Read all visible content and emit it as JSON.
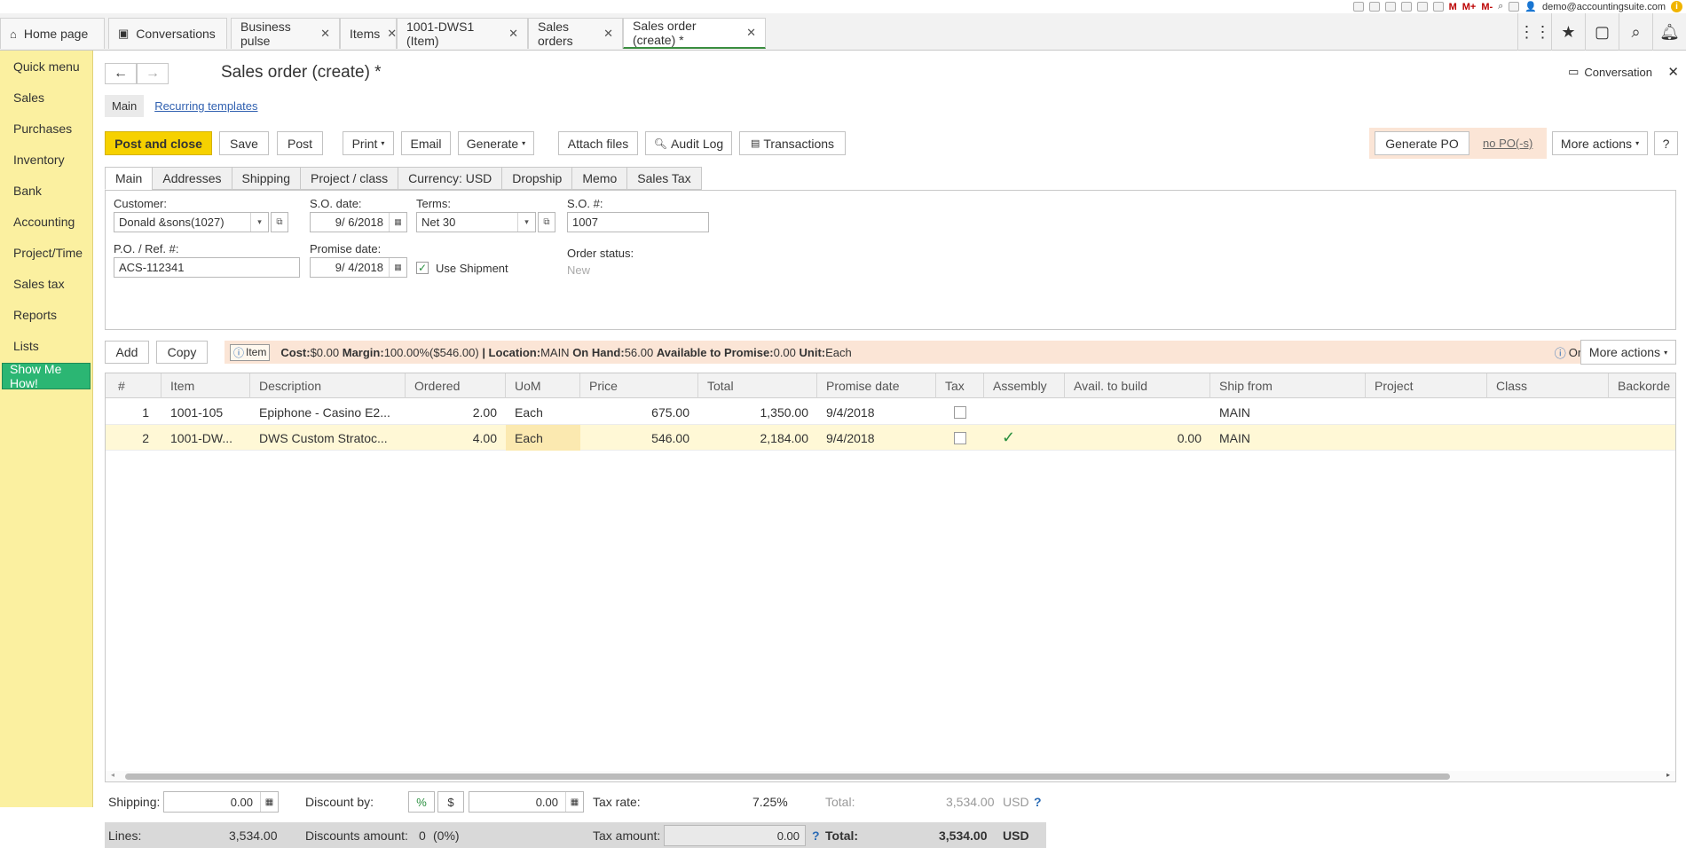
{
  "topbar": {
    "mplus": "M+",
    "mminus": "M-",
    "m": "M",
    "user": "demo@accountingsuite.com"
  },
  "open_tabs": [
    {
      "label": "Home page"
    },
    {
      "label": "Conversations"
    },
    {
      "label": "Business pulse"
    },
    {
      "label": "Items"
    },
    {
      "label": "1001-DWS1 (Item)"
    },
    {
      "label": "Sales orders"
    },
    {
      "label": "Sales order (create) *"
    }
  ],
  "sidebar": {
    "items": [
      {
        "label": "Quick menu"
      },
      {
        "label": "Sales"
      },
      {
        "label": "Purchases"
      },
      {
        "label": "Inventory"
      },
      {
        "label": "Bank"
      },
      {
        "label": "Accounting"
      },
      {
        "label": "Project/Time"
      },
      {
        "label": "Sales tax"
      },
      {
        "label": "Reports"
      },
      {
        "label": "Lists"
      }
    ],
    "show_me": "Show Me How!"
  },
  "page": {
    "title": "Sales order (create) *",
    "conversation": "Conversation",
    "subtab_main": "Main",
    "subtab_recurring": "Recurring templates"
  },
  "toolbar": {
    "post_close": "Post and close",
    "save": "Save",
    "post": "Post",
    "print": "Print",
    "email": "Email",
    "generate": "Generate",
    "attach": "Attach files",
    "audit": "Audit Log",
    "transactions": "Transactions",
    "generate_po": "Generate PO",
    "no_po": "no PO(-s)",
    "more_actions": "More actions",
    "help": "?"
  },
  "form_tabs": [
    "Main",
    "Addresses",
    "Shipping",
    "Project / class",
    "Currency: USD",
    "Dropship",
    "Memo",
    "Sales Tax"
  ],
  "form": {
    "customer_label": "Customer:",
    "customer_value": "Donald &sons(1027)",
    "so_date_label": "S.O. date:",
    "so_date_value": "9/ 6/2018",
    "terms_label": "Terms:",
    "terms_value": "Net 30",
    "so_num_label": "S.O. #:",
    "so_num_value": "1007",
    "po_label": "P.O. / Ref. #:",
    "po_value": "ACS-112341",
    "promise_label": "Promise date:",
    "promise_value": "9/ 4/2018",
    "use_shipment": "Use Shipment",
    "order_status_label": "Order status:",
    "order_status_value": "New"
  },
  "items_bar": {
    "add": "Add",
    "copy": "Copy",
    "item_tag": "Item",
    "cost_label": "Cost:",
    "cost_value": "$0.00",
    "margin_label": "Margin:",
    "margin_value": "100.00%($546.00)",
    "location_label": "| Location:",
    "location_value": "MAIN",
    "onhand_label": "On Hand:",
    "onhand_value": "56.00",
    "atp_label": "Available to Promise:",
    "atp_value": "0.00",
    "unit_label": "Unit:",
    "unit_value": "Each",
    "order": "Order",
    "more_actions": "More actions"
  },
  "grid": {
    "headers": [
      "#",
      "Item",
      "Description",
      "Ordered",
      "UoM",
      "Price",
      "Total",
      "Promise date",
      "Tax",
      "Assembly",
      "Avail. to build",
      "Ship from",
      "Project",
      "Class",
      "Backorde"
    ],
    "rows": [
      {
        "num": "1",
        "item": "1001-105",
        "description": "Epiphone - Casino E2...",
        "ordered": "2.00",
        "uom": "Each",
        "price": "675.00",
        "total": "1,350.00",
        "promise": "9/4/2018",
        "assembly": "",
        "avail": "",
        "ship_from": "MAIN"
      },
      {
        "num": "2",
        "item": "1001-DW...",
        "description": "DWS Custom Stratoc...",
        "ordered": "4.00",
        "uom": "Each",
        "price": "546.00",
        "total": "2,184.00",
        "promise": "9/4/2018",
        "assembly": "✓",
        "avail": "0.00",
        "ship_from": "MAIN"
      }
    ]
  },
  "footer": {
    "shipping_label": "Shipping:",
    "shipping_value": "0.00",
    "discount_label": "Discount by:",
    "pct": "%",
    "dollar": "$",
    "discount_value": "0.00",
    "tax_rate_label": "Tax rate:",
    "tax_rate_value": "7.25%",
    "total_label": "Total:",
    "total_value": "3,534.00",
    "currency": "USD",
    "lines_label": "Lines:",
    "lines_value": "3,534.00",
    "discounts_label": "Discounts amount:",
    "discounts_value": "0",
    "discounts_pct": "(0%)",
    "tax_amount_label": "Tax amount:",
    "tax_amount_value": "0.00",
    "total2_label": "Total:",
    "total2_value": "3,534.00",
    "currency2": "USD",
    "help": "?"
  }
}
